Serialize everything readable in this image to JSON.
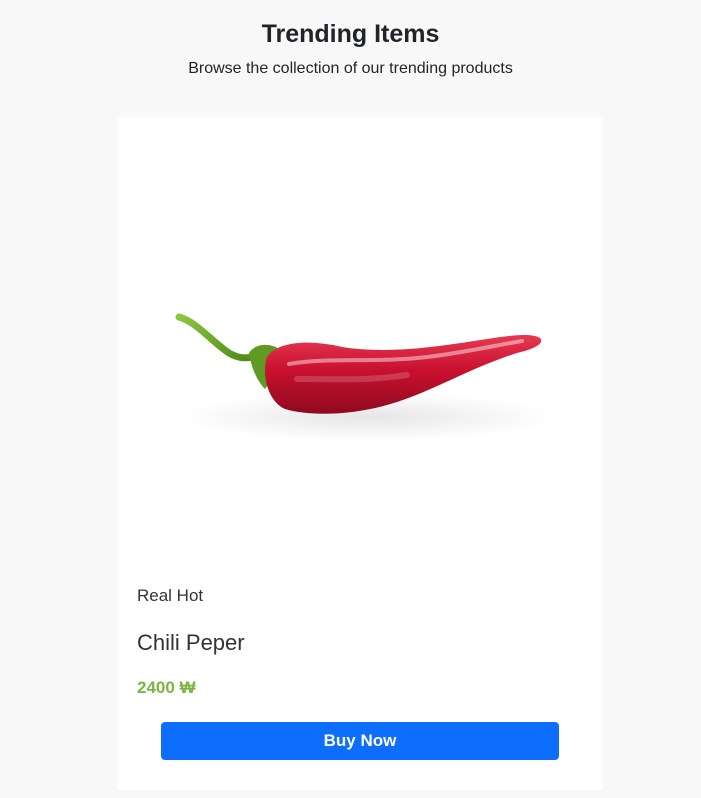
{
  "header": {
    "title": "Trending Items",
    "subtitle": "Browse the collection of our trending products"
  },
  "product": {
    "category": "Real Hot",
    "name": "Chili Peper",
    "price": "2400 ₩",
    "buy_label": "Buy Now",
    "image_subject": "red-chili-pepper"
  },
  "colors": {
    "page_background": "#f8f8f8",
    "card_background": "#ffffff",
    "price": "#7cb342",
    "button": "#0d6efd",
    "button_text": "#ffffff",
    "pepper_red": "#c8102e",
    "stem_green": "#6aa121"
  }
}
